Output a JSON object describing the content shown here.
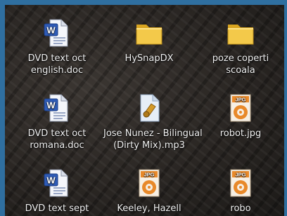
{
  "desktop": {
    "items": [
      {
        "line1": "DVD text oct",
        "line2": "english.doc",
        "icon": "word-document-icon"
      },
      {
        "line1": "HySnapDX",
        "line2": "",
        "icon": "folder-icon"
      },
      {
        "line1": "poze coperti",
        "line2": "scoala",
        "icon": "folder-icon"
      },
      {
        "line1": "DVD text oct",
        "line2": "romana.doc",
        "icon": "word-document-icon"
      },
      {
        "line1": "Jose Nunez - Bilingual",
        "line2": "(Dirty Mix).mp3",
        "icon": "audio-file-icon"
      },
      {
        "line1": "robot.jpg",
        "line2": "",
        "icon": "jpg-image-icon"
      },
      {
        "line1": "DVD text sept",
        "line2": "",
        "icon": "word-document-icon"
      },
      {
        "line1": "Keeley, Hazell",
        "line2": "",
        "icon": "jpg-image-icon"
      },
      {
        "line1": "robo",
        "line2": "",
        "icon": "jpg-image-icon"
      }
    ]
  },
  "colors": {
    "frame": "#2f6fa0",
    "folder": "#f0c040",
    "jpg_orange": "#e8892a"
  }
}
